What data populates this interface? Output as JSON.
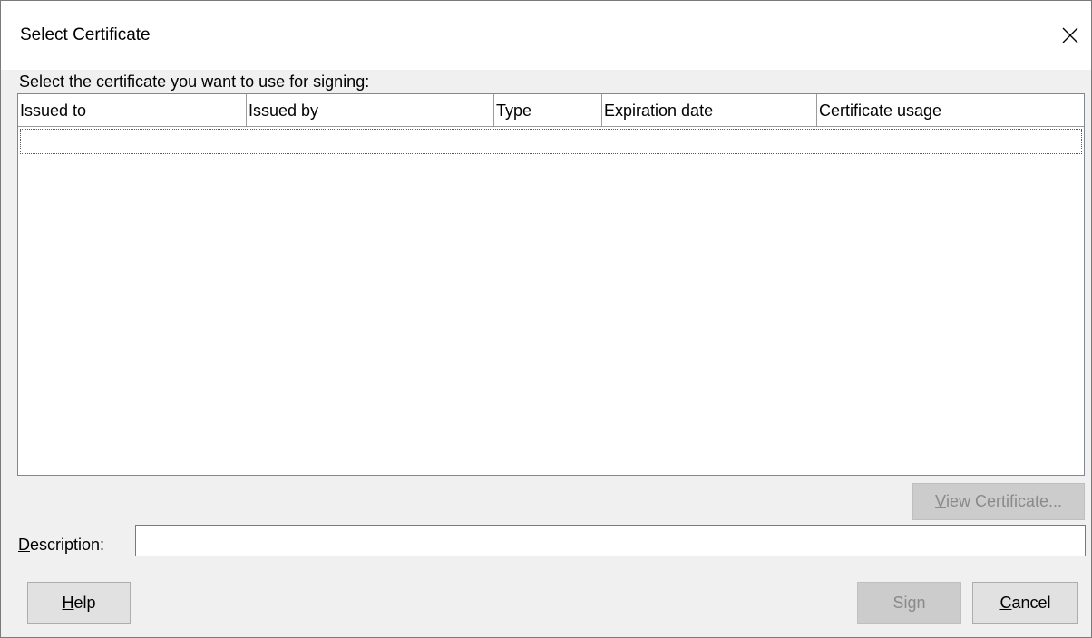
{
  "dialog": {
    "title": "Select Certificate",
    "prompt": "Select the certificate you want to use for signing:"
  },
  "table": {
    "columns": [
      "Issued to",
      "Issued by",
      "Type",
      "Expiration date",
      "Certificate usage"
    ],
    "rows": []
  },
  "buttons": {
    "view_certificate": {
      "mnemonic": "V",
      "rest": "iew Certificate...",
      "enabled": false
    },
    "help": {
      "mnemonic": "H",
      "rest": "elp",
      "enabled": true
    },
    "sign": {
      "label": "Sign",
      "enabled": false
    },
    "cancel": {
      "mnemonic": "C",
      "rest": "ancel",
      "enabled": true
    }
  },
  "description": {
    "label_mnemonic": "D",
    "label_rest": "escription:",
    "value": ""
  },
  "icons": {
    "close": "close-icon"
  }
}
